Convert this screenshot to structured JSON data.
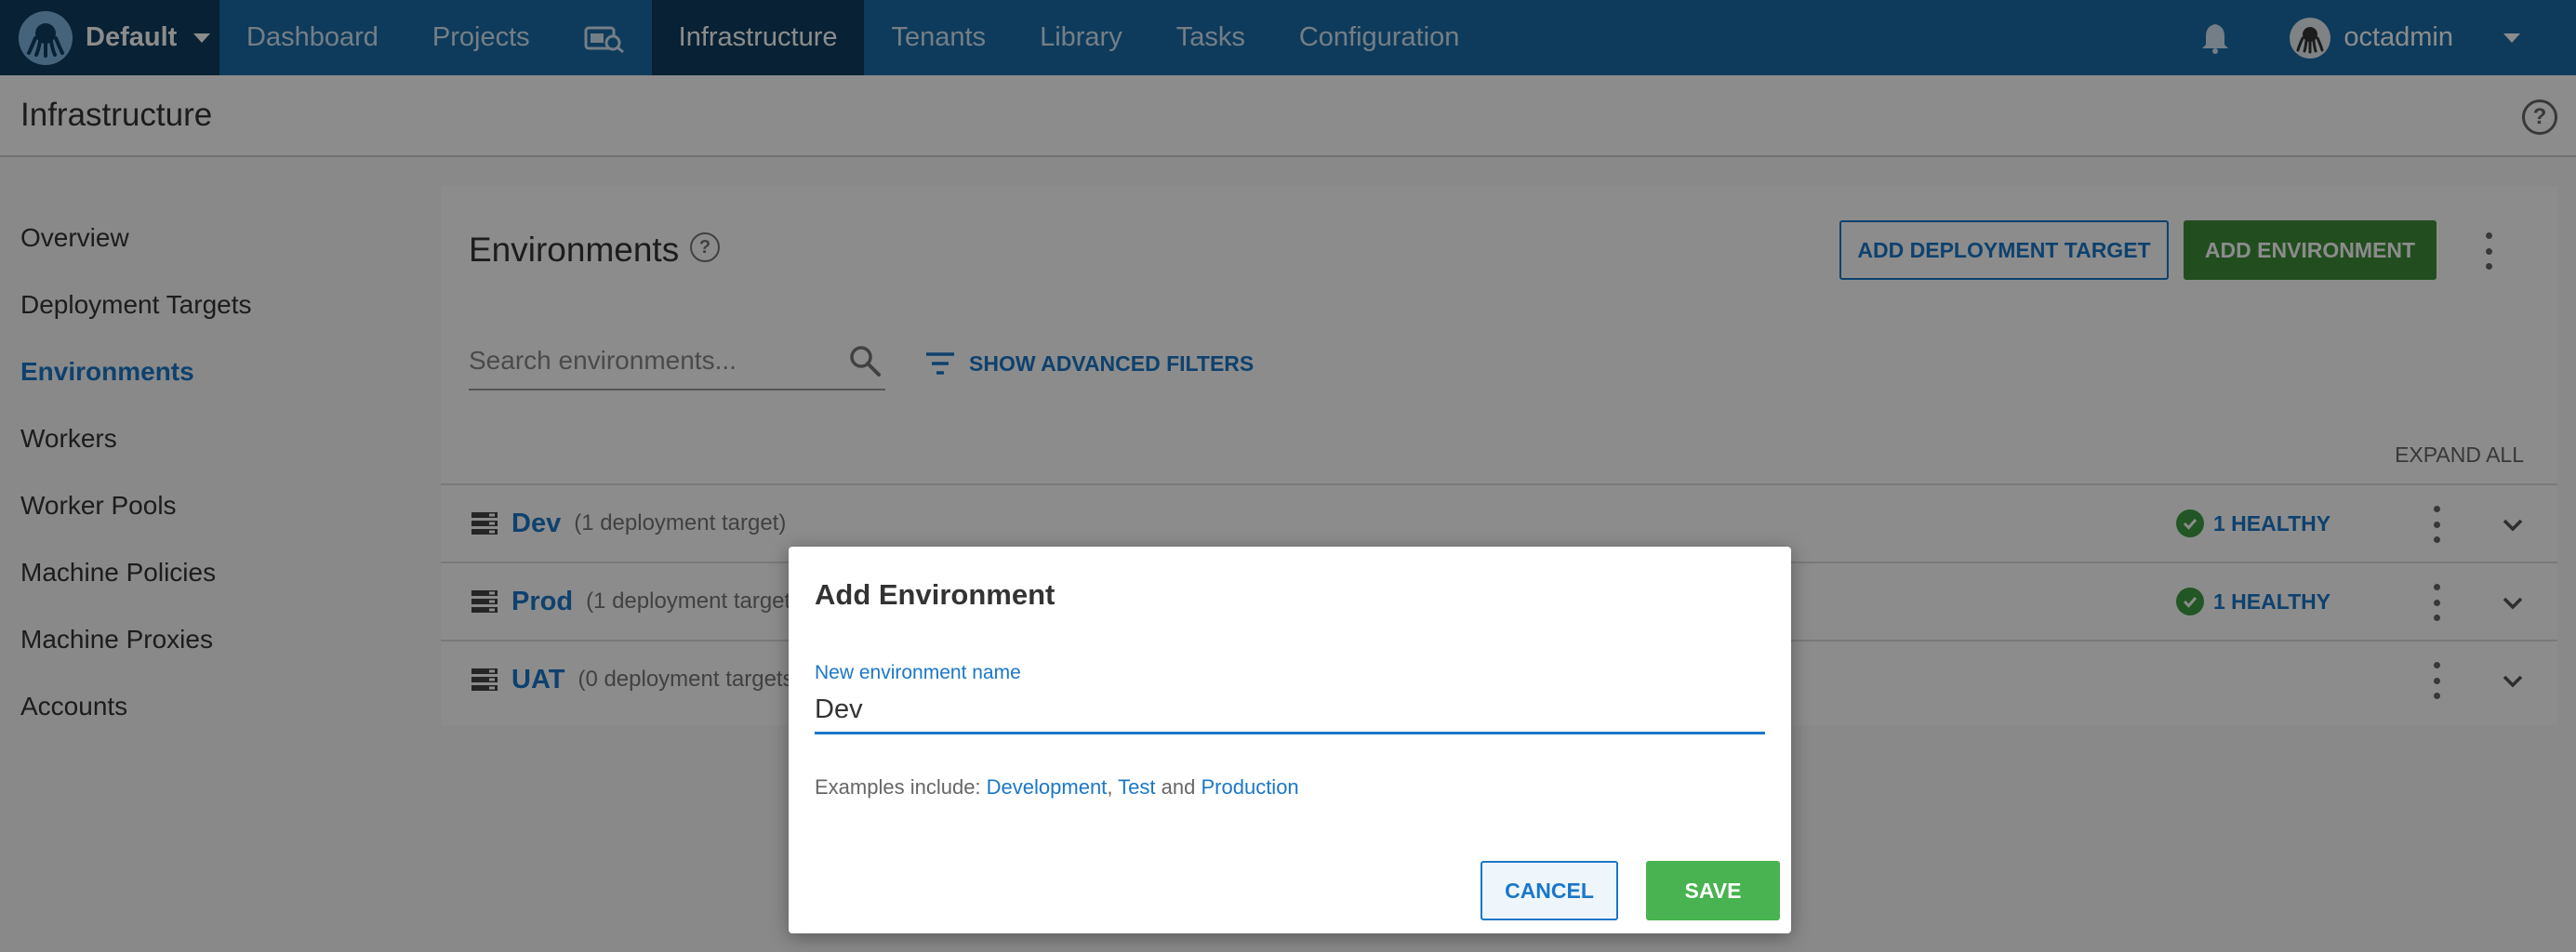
{
  "topnav": {
    "space_name": "Default",
    "items": [
      {
        "label": "Dashboard"
      },
      {
        "label": "Projects"
      },
      {
        "label": "Infrastructure"
      },
      {
        "label": "Tenants"
      },
      {
        "label": "Library"
      },
      {
        "label": "Tasks"
      },
      {
        "label": "Configuration"
      }
    ],
    "active_item": "Infrastructure",
    "username": "octadmin"
  },
  "page": {
    "title": "Infrastructure",
    "help": "?"
  },
  "sidebar": {
    "items": [
      {
        "label": "Overview"
      },
      {
        "label": "Deployment Targets"
      },
      {
        "label": "Environments"
      },
      {
        "label": "Workers"
      },
      {
        "label": "Worker Pools"
      },
      {
        "label": "Machine Policies"
      },
      {
        "label": "Machine Proxies"
      },
      {
        "label": "Accounts"
      }
    ],
    "active_item": "Environments"
  },
  "card": {
    "title": "Environments",
    "help": "?",
    "add_target_label": "ADD DEPLOYMENT TARGET",
    "add_env_label": "ADD ENVIRONMENT",
    "search_placeholder": "Search environments...",
    "filters_label": "SHOW ADVANCED FILTERS",
    "expand_all_label": "EXPAND ALL",
    "environments": [
      {
        "name": "Dev",
        "targets": "(1 deployment target)",
        "health": "1 HEALTHY"
      },
      {
        "name": "Prod",
        "targets": "(1 deployment target)",
        "health": "1 HEALTHY"
      },
      {
        "name": "UAT",
        "targets": "(0 deployment targets)",
        "health": ""
      }
    ]
  },
  "dialog": {
    "title": "Add Environment",
    "field_label": "New environment name",
    "field_value": "Dev",
    "examples_prefix": "Examples include:",
    "examples": [
      "Development",
      "Test",
      "Production"
    ],
    "examples_sep": ",",
    "examples_and": "and",
    "cancel_label": "CANCEL",
    "save_label": "SAVE"
  },
  "colors": {
    "nav_bg": "#1b6ca8",
    "nav_active_bg": "#0f3c5f",
    "link_blue": "#1a77c9",
    "add_env_green": "#3e8e3a",
    "save_green": "#48b350",
    "healthy_green": "#3e9d44"
  },
  "icons": {
    "logo": "octopus-logo-icon",
    "projects_search": "binoculars-search-icon",
    "notifications": "bell-icon",
    "user": "user-avatar-icon",
    "search": "search-icon",
    "filter": "filter-icon",
    "environment": "server-stack-icon",
    "healthy": "check-circle-icon",
    "more": "kebab-menu-icon",
    "expand": "chevron-down-icon",
    "help": "help-circle-icon"
  }
}
